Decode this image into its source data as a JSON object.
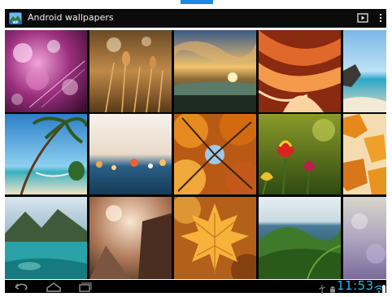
{
  "action_bar": {
    "title": "Android wallpapers",
    "app_icon": "wallpaper-app-icon",
    "slideshow_icon": "slideshow-play-icon",
    "overflow_icon": "overflow-menu-icon"
  },
  "grid": {
    "columns": 5,
    "rows": 3,
    "wallpapers": [
      {
        "subject": "pink-bokeh-lights"
      },
      {
        "subject": "golden-grass"
      },
      {
        "subject": "sunset-over-lake"
      },
      {
        "subject": "orange-sandstone-canyon"
      },
      {
        "subject": "beach-rocks"
      },
      {
        "subject": "palm-tree-hammock"
      },
      {
        "subject": "blue-street-bokeh"
      },
      {
        "subject": "autumn-trees-from-below"
      },
      {
        "subject": "tulips"
      },
      {
        "subject": "orange-autumn-leaves"
      },
      {
        "subject": "mountain-lake"
      },
      {
        "subject": "sunlit-vintage-street"
      },
      {
        "subject": "maple-leaf"
      },
      {
        "subject": "green-hills"
      },
      {
        "subject": "soft-purple-bokeh"
      }
    ]
  },
  "nav_bar": {
    "back_icon": "back-icon",
    "home_icon": "home-icon",
    "recents_icon": "recent-apps-icon",
    "usb_icon": "usb-icon",
    "android_icon": "android-debug-icon",
    "clock": "11:53",
    "wifi_icon": "wifi-icon",
    "battery_icon": "battery-icon"
  },
  "colors": {
    "action_bar_bg": "#0b0b0b",
    "accent": "#33b5e5"
  }
}
